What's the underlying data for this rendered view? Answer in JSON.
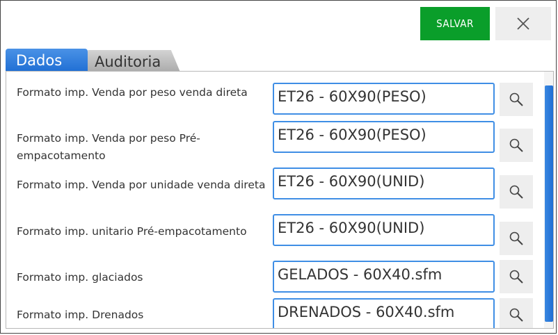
{
  "toolbar": {
    "save_label": "SALVAR"
  },
  "tabs": [
    {
      "label": "Dados",
      "active": true
    },
    {
      "label": "Auditoria",
      "active": false
    }
  ],
  "fields": [
    {
      "label": "Formato imp. Venda por peso venda direta",
      "value": "ET26 - 60X90(PESO)"
    },
    {
      "label": "Formato imp. Venda por peso Pré-empacotamento",
      "value": "ET26 - 60X90(PESO)"
    },
    {
      "label": "Formato imp. Venda por unidade venda direta",
      "value": "ET26 - 60X90(UNID)"
    },
    {
      "label": "Formato imp. unitario Pré-empacotamento",
      "value": "ET26 - 60X90(UNID)"
    },
    {
      "label": "Formato imp. glaciados",
      "value": "GELADOS - 60X40.sfm"
    },
    {
      "label": "Formato imp. Drenados",
      "value": "DRENADOS - 60X40.sfm"
    }
  ],
  "colors": {
    "save": "#0a9e2a",
    "accent": "#1f6ed4",
    "field_border": "#3f8ee5"
  },
  "icons": {
    "close": "close-icon",
    "search": "search-icon"
  }
}
